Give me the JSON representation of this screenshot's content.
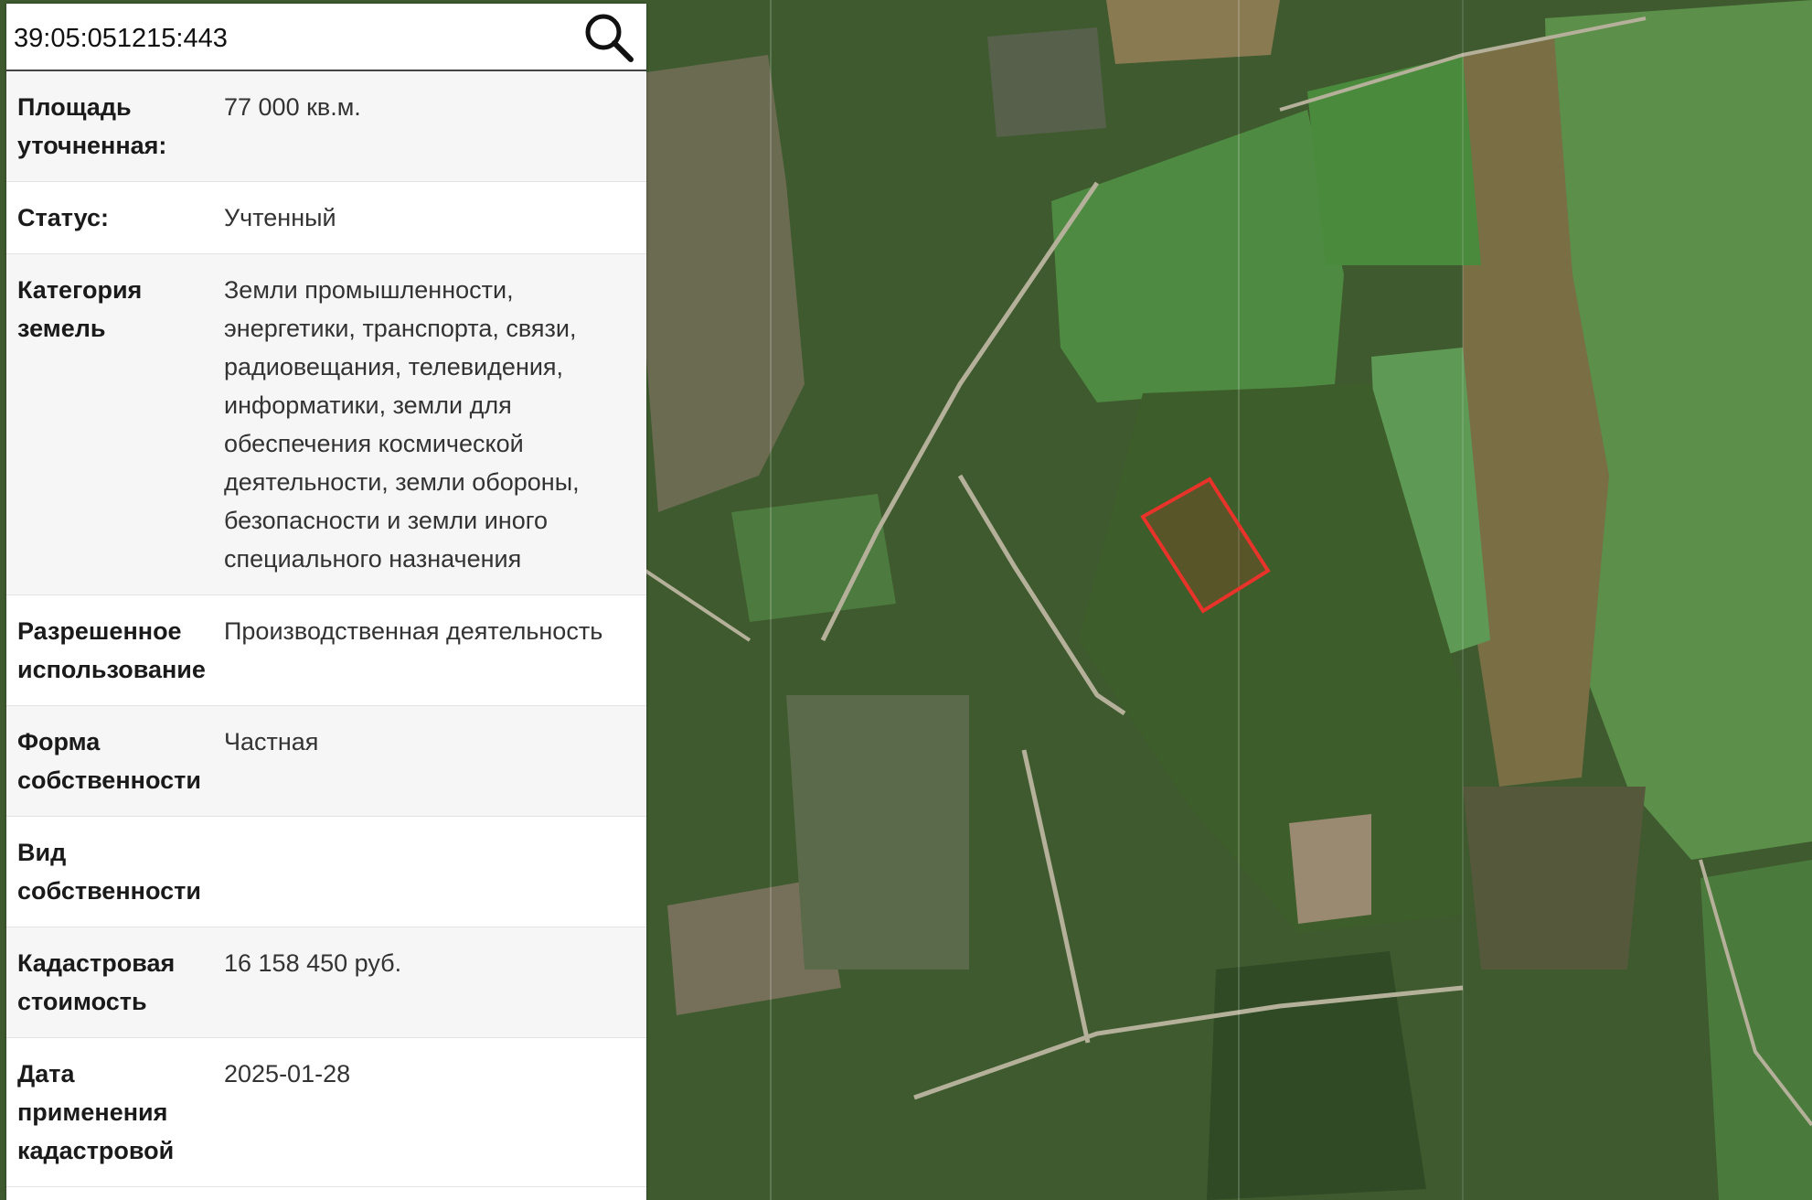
{
  "search": {
    "value": "39:05:051215:443",
    "placeholder": ""
  },
  "icons": {
    "search": "search-icon"
  },
  "colors": {
    "parcel_outline": "#e8332a",
    "panel_bg": "#ffffff",
    "row_alt_bg": "#f6f6f6"
  },
  "parcel_info": [
    {
      "label": "Площадь уточненная:",
      "value": "77 000 кв.м."
    },
    {
      "label": "Статус:",
      "value": "Учтенный"
    },
    {
      "label": "Категория земель",
      "value": "Земли промышленности, энергетики, транспорта, связи, радиовещания, телевидения, информатики, земли для обеспечения космической деятельности, земли обороны, безопасности и земли иного специального назначения"
    },
    {
      "label": "Разрешенное использование",
      "value": "Производственная деятельность"
    },
    {
      "label": "Форма собственности",
      "value": "Частная"
    },
    {
      "label": "Вид собственности",
      "value": ""
    },
    {
      "label": "Кадастровая стоимость",
      "value": "16 158 450 руб."
    },
    {
      "label": "Дата применения кадастровой",
      "value": "2025-01-28"
    }
  ]
}
